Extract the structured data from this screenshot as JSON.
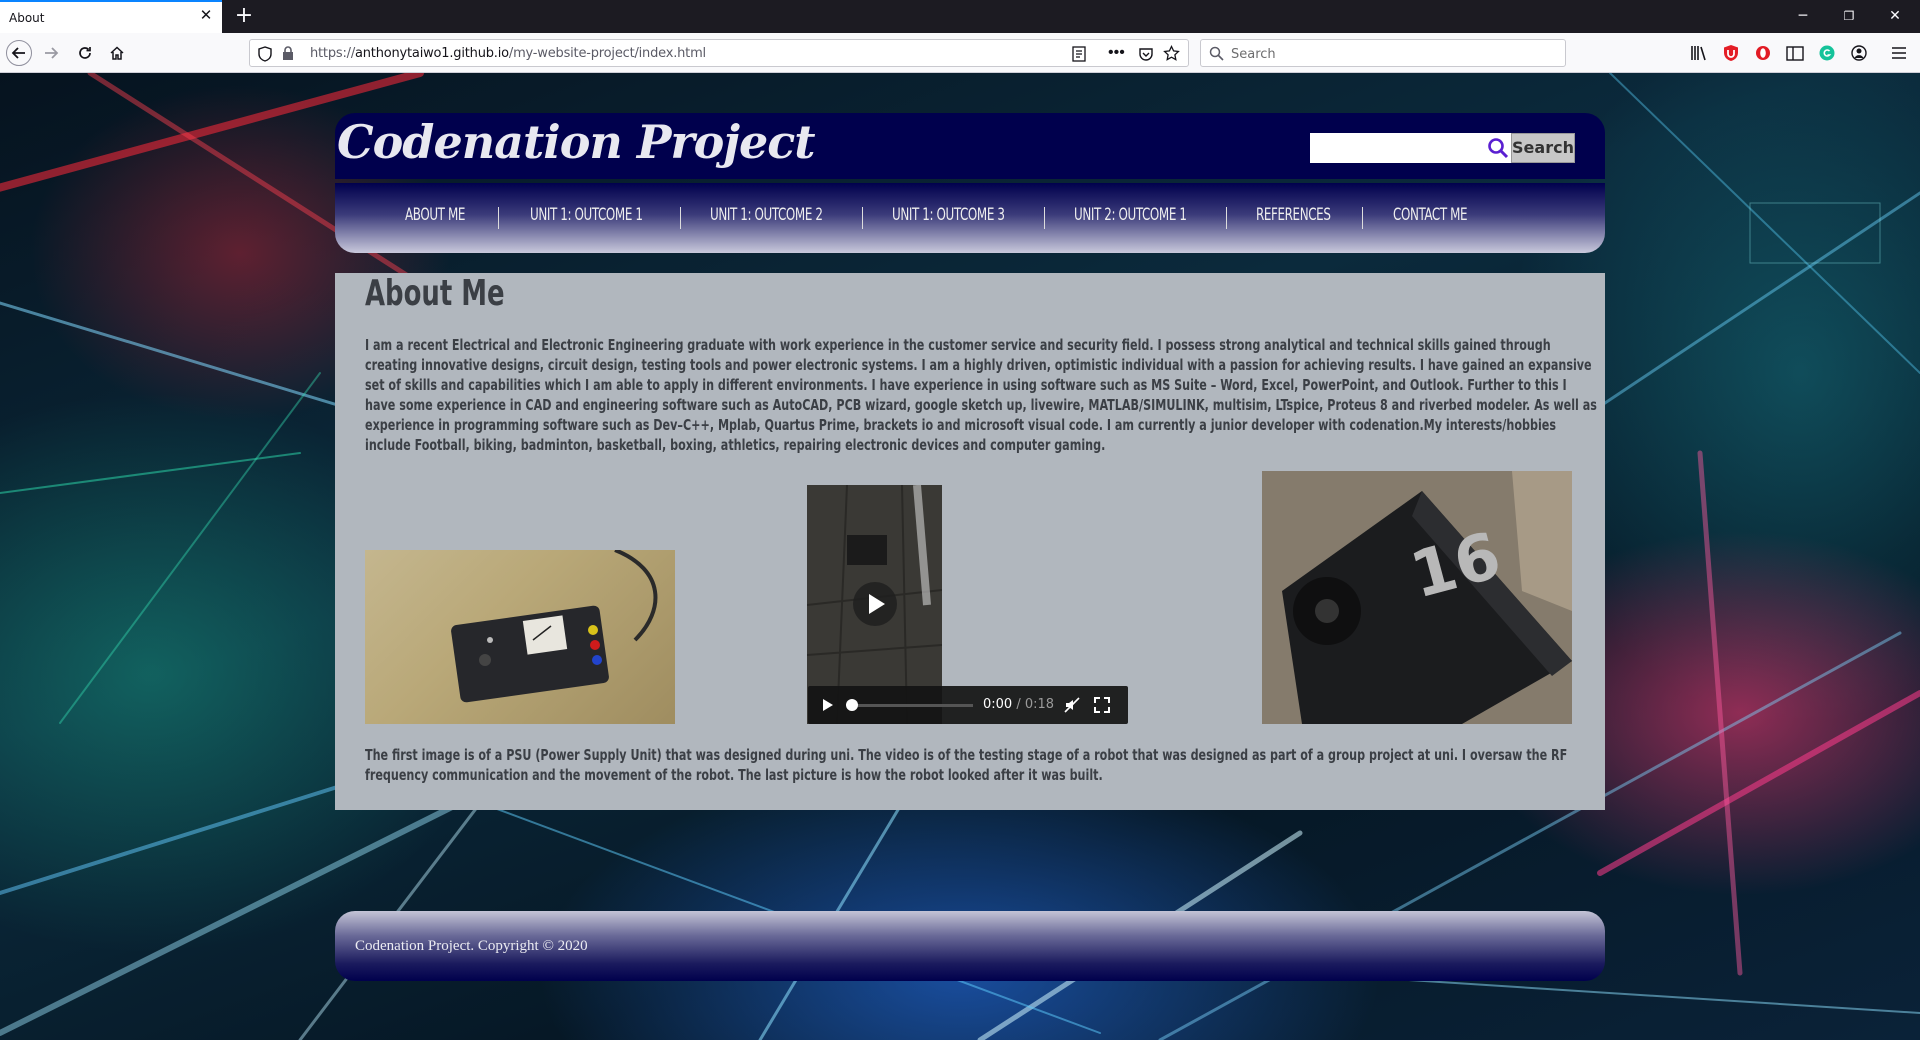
{
  "browser": {
    "tab_title": "About",
    "tab_close_glyph": "✕",
    "new_tab_glyph": "+",
    "url_prefix": "https://",
    "url_host": "anthonytaiwo1.github.io",
    "url_path": "/my-website-project/index.html",
    "search_placeholder": "Search",
    "window_controls": [
      "─",
      "❐",
      "✕"
    ],
    "toolbar_icons": [
      "reader-view-icon",
      "more-actions-icon",
      "pocket-icon",
      "bookmark-star-icon",
      "library-icon",
      "ublock-icon",
      "opera-icon",
      "sidebar-icon",
      "grammarly-icon",
      "account-icon",
      "menu-icon"
    ]
  },
  "site": {
    "logo": "Codenation Project",
    "search_button": "Search",
    "nav": [
      {
        "label": "ABOUT ME"
      },
      {
        "label": "UNIT 1: OUTCOME 1"
      },
      {
        "label": "UNIT 1: OUTCOME 2"
      },
      {
        "label": "UNIT 1: OUTCOME 3"
      },
      {
        "label": "UNIT 2: OUTCOME 1"
      },
      {
        "label": "REFERENCES"
      },
      {
        "label": "CONTACT ME"
      }
    ]
  },
  "main": {
    "title": "About Me",
    "paragraph_1": "I am a recent Electrical and Electronic Engineering graduate with work experience in the customer service and security field. I possess strong analytical and technical skills gained through creating innovative designs, circuit design, testing tools and power electronic systems. I am a highly driven, optimistic individual with a passion for achieving results. I have gained an expansive set of skills and capabilities which I am able to apply in different environments. I have experience in using software such as MS Suite – Word, Excel, PowerPoint, and Outlook. Further to this I have some experience in CAD and engineering software such as AutoCAD, PCB wizard, google sketch up, livewire, MATLAB/SIMULINK, multisim, LTspice, Proteus 8 and riverbed modeler. As well as experience in programming software such as Dev–C++, Mplab, Quartus Prime, brackets io and microsoft visual code. I am currently a junior developer with codenation.My interests/hobbies include Football, biking, badminton, basketball, boxing, athletics, repairing electronic devices and computer gaming.",
    "video": {
      "current_time": "0:00",
      "separator": " / ",
      "duration": "0:18",
      "progress_fraction": 0
    },
    "robot_number": "16",
    "paragraph_2": "The first image is of a PSU (Power Supply Unit) that was designed during uni. The video is of the testing stage of a robot that was designed as part of a group project at uni. I oversaw the RF frequency communication and the movement of the robot. The last picture is how the robot looked after it was built."
  },
  "footer": {
    "text": "Codenation Project. Copyright © 2020"
  },
  "colors": {
    "header_navy": "#00004d",
    "content_gray": "#b1b7be",
    "text_dark": "#3b3f45",
    "search_icon": "#5a1fd1"
  }
}
